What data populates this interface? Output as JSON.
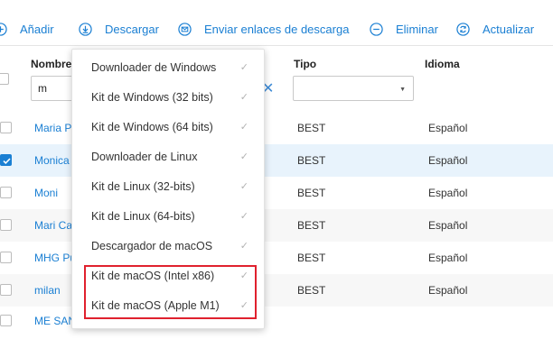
{
  "toolbar": {
    "add_label": "Añadir",
    "download_label": "Descargar",
    "send_links_label": "Enviar enlaces de descarga",
    "delete_label": "Eliminar",
    "refresh_label": "Actualizar"
  },
  "table": {
    "columns": {
      "name": "Nombre",
      "type": "Tipo",
      "language": "Idioma"
    },
    "filter": {
      "name_value": "m",
      "type_value": ""
    },
    "rows": [
      {
        "name": "Maria P",
        "type": "BEST",
        "language": "Español",
        "checked": false
      },
      {
        "name": "Monica",
        "type": "BEST",
        "language": "Español",
        "checked": true
      },
      {
        "name": "Moni",
        "type": "BEST",
        "language": "Español",
        "checked": false
      },
      {
        "name": "Mari Ca",
        "type": "BEST",
        "language": "Español",
        "checked": false
      },
      {
        "name": "MHG Pu",
        "type": "BEST",
        "language": "Español",
        "checked": false
      },
      {
        "name": "milan",
        "type": "BEST",
        "language": "Español",
        "checked": false
      },
      {
        "name": "ME SAN",
        "type": "",
        "language": "",
        "checked": false
      }
    ]
  },
  "download_menu": {
    "items": [
      "Downloader de Windows",
      "Kit de Windows (32 bits)",
      "Kit de Windows (64 bits)",
      "Downloader de Linux",
      "Kit de Linux (32-bits)",
      "Kit de Linux (64-bits)",
      "Descargador de macOS",
      "Kit de macOS (Intel x86)",
      "Kit de macOS (Apple M1)"
    ],
    "check_glyph": "✓",
    "highlight_color": "#e0212e"
  },
  "colors": {
    "accent": "#1a7fd3",
    "selected_row": "#e8f3fc"
  }
}
